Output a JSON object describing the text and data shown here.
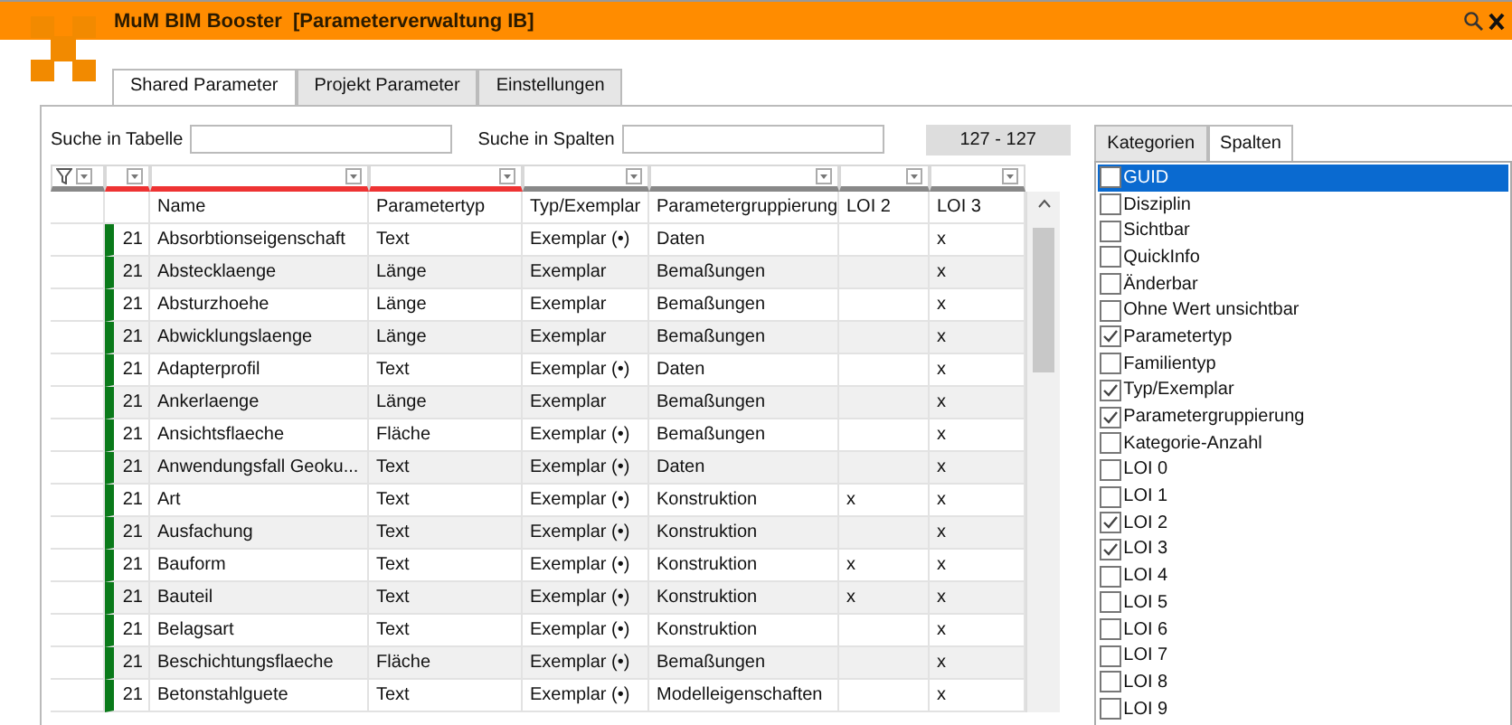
{
  "window": {
    "title": "MuM BIM Booster  [Parameterverwaltung IB]"
  },
  "tabs": [
    {
      "label": "Shared Parameter",
      "selected": true
    },
    {
      "label": "Projekt Parameter",
      "selected": false
    },
    {
      "label": "Einstellungen",
      "selected": false
    }
  ],
  "search": {
    "table_label": "Suche in Tabelle",
    "columns_label": "Suche in Spalten",
    "count": "127 - 127"
  },
  "table": {
    "columns": [
      {
        "filtered": true
      },
      {
        "label": "Name",
        "filtered": true
      },
      {
        "label": "Parametertyp",
        "filtered": true
      },
      {
        "label": "Typ/Exemplar",
        "filtered": false
      },
      {
        "label": "Parametergruppierung",
        "filtered": false
      },
      {
        "label": "LOI 2",
        "filtered": false
      },
      {
        "label": "LOI 3",
        "filtered": false
      }
    ],
    "rows": [
      {
        "count": "21",
        "name": "Absorbtionseigenschaft",
        "type": "Text",
        "instance": "Exemplar (•)",
        "group": "Daten",
        "loi3": "x"
      },
      {
        "count": "21",
        "name": "Abstecklaenge",
        "type": "Länge",
        "instance": "Exemplar",
        "group": "Bemaßungen",
        "loi3": "x"
      },
      {
        "count": "21",
        "name": "Absturzhoehe",
        "type": "Länge",
        "instance": "Exemplar",
        "group": "Bemaßungen",
        "loi3": "x"
      },
      {
        "count": "21",
        "name": "Abwicklungslaenge",
        "type": "Länge",
        "instance": "Exemplar",
        "group": "Bemaßungen",
        "loi3": "x"
      },
      {
        "count": "21",
        "name": "Adapterprofil",
        "type": "Text",
        "instance": "Exemplar (•)",
        "group": "Daten",
        "loi3": "x"
      },
      {
        "count": "21",
        "name": "Ankerlaenge",
        "type": "Länge",
        "instance": "Exemplar",
        "group": "Bemaßungen",
        "loi3": "x"
      },
      {
        "count": "21",
        "name": "Ansichtsflaeche",
        "type": "Fläche",
        "instance": "Exemplar (•)",
        "group": "Bemaßungen",
        "loi3": "x"
      },
      {
        "count": "21",
        "name": "Anwendungsfall Geoku...",
        "type": "Text",
        "instance": "Exemplar (•)",
        "group": "Daten",
        "loi3": "x"
      },
      {
        "count": "21",
        "name": "Art",
        "type": "Text",
        "instance": "Exemplar (•)",
        "group": "Konstruktion",
        "loi2": "x",
        "loi3": "x"
      },
      {
        "count": "21",
        "name": "Ausfachung",
        "type": "Text",
        "instance": "Exemplar (•)",
        "group": "Konstruktion",
        "loi3": "x"
      },
      {
        "count": "21",
        "name": "Bauform",
        "type": "Text",
        "instance": "Exemplar (•)",
        "group": "Konstruktion",
        "loi2": "x",
        "loi3": "x"
      },
      {
        "count": "21",
        "name": "Bauteil",
        "type": "Text",
        "instance": "Exemplar (•)",
        "group": "Konstruktion",
        "loi2": "x",
        "loi3": "x"
      },
      {
        "count": "21",
        "name": "Belagsart",
        "type": "Text",
        "instance": "Exemplar (•)",
        "group": "Konstruktion",
        "loi3": "x"
      },
      {
        "count": "21",
        "name": "Beschichtungsflaeche",
        "type": "Fläche",
        "instance": "Exemplar (•)",
        "group": "Bemaßungen",
        "loi3": "x"
      },
      {
        "count": "21",
        "name": "Betonstahlguete",
        "type": "Text",
        "instance": "Exemplar (•)",
        "group": "Modelleigenschaften",
        "loi3": "x"
      }
    ]
  },
  "side_panel": {
    "tabs": [
      {
        "label": "Kategorien",
        "selected": false
      },
      {
        "label": "Spalten",
        "selected": true
      }
    ],
    "columns": [
      {
        "label": "GUID",
        "checked": false,
        "selected": true
      },
      {
        "label": "Disziplin",
        "checked": false,
        "selected": false
      },
      {
        "label": "Sichtbar",
        "checked": false,
        "selected": false
      },
      {
        "label": "QuickInfo",
        "checked": false,
        "selected": false
      },
      {
        "label": "Änderbar",
        "checked": false,
        "selected": false
      },
      {
        "label": "Ohne Wert unsichtbar",
        "checked": false,
        "selected": false
      },
      {
        "label": "Parametertyp",
        "checked": true,
        "selected": false
      },
      {
        "label": "Familientyp",
        "checked": false,
        "selected": false
      },
      {
        "label": "Typ/Exemplar",
        "checked": true,
        "selected": false
      },
      {
        "label": "Parametergruppierung",
        "checked": true,
        "selected": false
      },
      {
        "label": "Kategorie-Anzahl",
        "checked": false,
        "selected": false
      },
      {
        "label": "LOI 0",
        "checked": false,
        "selected": false
      },
      {
        "label": "LOI 1",
        "checked": false,
        "selected": false
      },
      {
        "label": "LOI 2",
        "checked": true,
        "selected": false
      },
      {
        "label": "LOI 3",
        "checked": true,
        "selected": false
      },
      {
        "label": "LOI 4",
        "checked": false,
        "selected": false
      },
      {
        "label": "LOI 5",
        "checked": false,
        "selected": false
      },
      {
        "label": "LOI 6",
        "checked": false,
        "selected": false
      },
      {
        "label": "LOI 7",
        "checked": false,
        "selected": false
      },
      {
        "label": "LOI 8",
        "checked": false,
        "selected": false
      },
      {
        "label": "LOI 9",
        "checked": false,
        "selected": false
      }
    ]
  }
}
